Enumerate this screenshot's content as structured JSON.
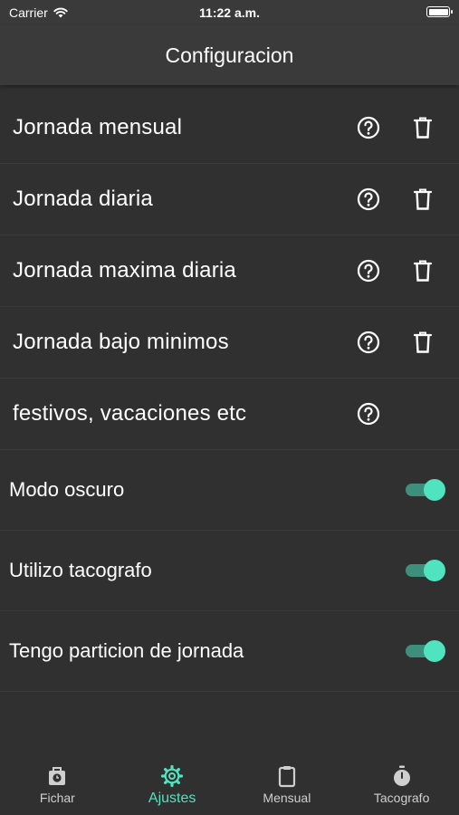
{
  "status_bar": {
    "carrier": "Carrier",
    "time": "11:22 a.m."
  },
  "header": {
    "title": "Configuracion"
  },
  "settings": [
    {
      "label": "Jornada mensual"
    },
    {
      "label": "Jornada diaria"
    },
    {
      "label": "Jornada maxima diaria"
    },
    {
      "label": "Jornada bajo minimos"
    },
    {
      "label": "festivos, vacaciones etc"
    }
  ],
  "toggles": [
    {
      "label": "Modo oscuro",
      "on": true
    },
    {
      "label": "Utilizo tacografo",
      "on": true
    },
    {
      "label": "Tengo particion de jornada",
      "on": true
    }
  ],
  "tabs": [
    {
      "label": "Fichar",
      "icon": "bag-clock-icon"
    },
    {
      "label": "Ajustes",
      "icon": "gear-icon",
      "active": true
    },
    {
      "label": "Mensual",
      "icon": "clipboard-icon"
    },
    {
      "label": "Tacografo",
      "icon": "stopwatch-icon"
    }
  ],
  "colors": {
    "accent": "#4fe3c0",
    "track": "#3d8f7c",
    "background": "#303030",
    "bar": "#3a3a3a"
  }
}
